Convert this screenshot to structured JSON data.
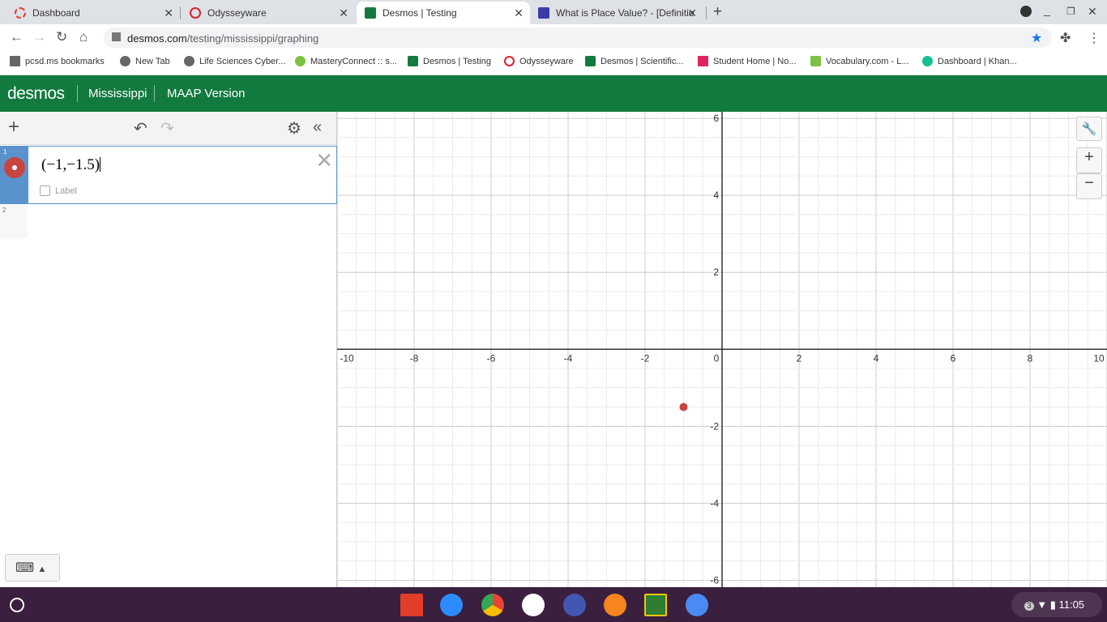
{
  "browser": {
    "tabs": [
      {
        "title": "Dashboard",
        "favicon_color": "#e23d28",
        "active": false
      },
      {
        "title": "Odysseyware",
        "favicon_color": "#d7232d",
        "active": false
      },
      {
        "title": "Desmos | Testing",
        "favicon_color": "#127a3e",
        "active": true
      },
      {
        "title": "What is Place Value? - [Definitio",
        "favicon_color": "#3a3aa8",
        "active": false
      }
    ],
    "url_host": "desmos.com",
    "url_path": "/testing/mississippi/graphing",
    "bookmarks": [
      {
        "label": "pcsd.ms bookmarks",
        "color": "#666"
      },
      {
        "label": "New Tab",
        "color": "#666"
      },
      {
        "label": "Life Sciences Cyber...",
        "color": "#666"
      },
      {
        "label": "MasteryConnect :: s...",
        "color": "#7cc242"
      },
      {
        "label": "Desmos | Testing",
        "color": "#127a3e"
      },
      {
        "label": "Odysseyware",
        "color": "#d7232d"
      },
      {
        "label": "Desmos | Scientific...",
        "color": "#127a3e"
      },
      {
        "label": "Student Home | No...",
        "color": "#e0245e"
      },
      {
        "label": "Vocabulary.com - L...",
        "color": "#7cc242"
      },
      {
        "label": "Dashboard | Khan...",
        "color": "#14bf96"
      }
    ]
  },
  "header": {
    "logo": "desmos",
    "items": [
      "Mississippi",
      "MAAP Version"
    ],
    "color": "#127a3e"
  },
  "expressions": [
    {
      "index": "1",
      "latex": "(−1,−1.5)",
      "color": "#c74440",
      "label_checkbox": "Label"
    },
    {
      "index": "2",
      "latex": ""
    }
  ],
  "graph": {
    "xlim": [
      -10,
      10
    ],
    "ylim": [
      -6.18,
      6.17
    ],
    "x_ticks": [
      -10,
      -8,
      -6,
      -4,
      -2,
      0,
      2,
      4,
      6,
      8,
      10
    ],
    "y_ticks": [
      -6,
      -4,
      -2,
      2,
      4,
      6
    ],
    "minor_step": 0.5,
    "points": [
      {
        "x": -1,
        "y": -1.5,
        "color": "#c74440"
      }
    ]
  },
  "taskbar": {
    "time": "11:05",
    "notifications": "3",
    "apps": [
      "Canvas",
      "Zoom",
      "Chrome",
      "App",
      "Quizlet",
      "Student",
      "Classroom",
      "Files"
    ]
  }
}
